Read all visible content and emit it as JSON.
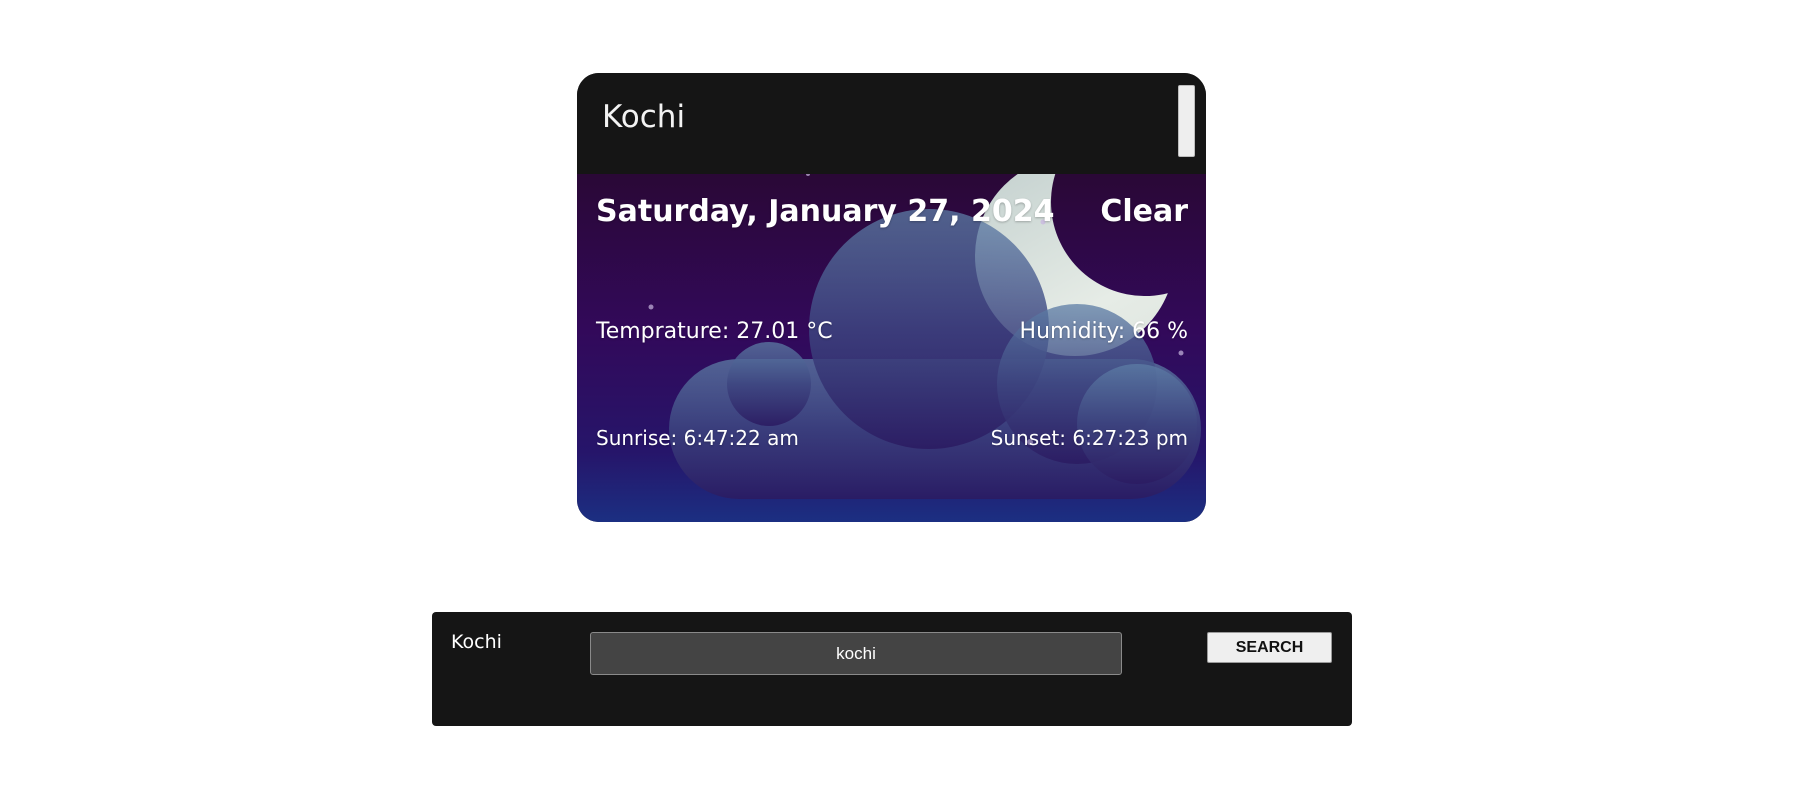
{
  "card": {
    "city": "Kochi",
    "date": "Saturday, January 27, 2024",
    "condition": "Clear",
    "temperature": "Temprature: 27.01 °C",
    "humidity": "Humidity: 66 %",
    "sunrise": "Sunrise: 6:47:22 am",
    "sunset": "Sunset: 6:27:23 pm",
    "scene_icons": [
      "moon-icon",
      "cloud-icon",
      "stars"
    ]
  },
  "search": {
    "city": "Kochi",
    "input_value": "kochi",
    "button_label": "SEARCH"
  },
  "colors": {
    "panel_bg": "#151515",
    "sky_top": "#2a0a3a",
    "sky_mid": "#2f0a5c",
    "sky_bottom": "#1b2e80"
  }
}
